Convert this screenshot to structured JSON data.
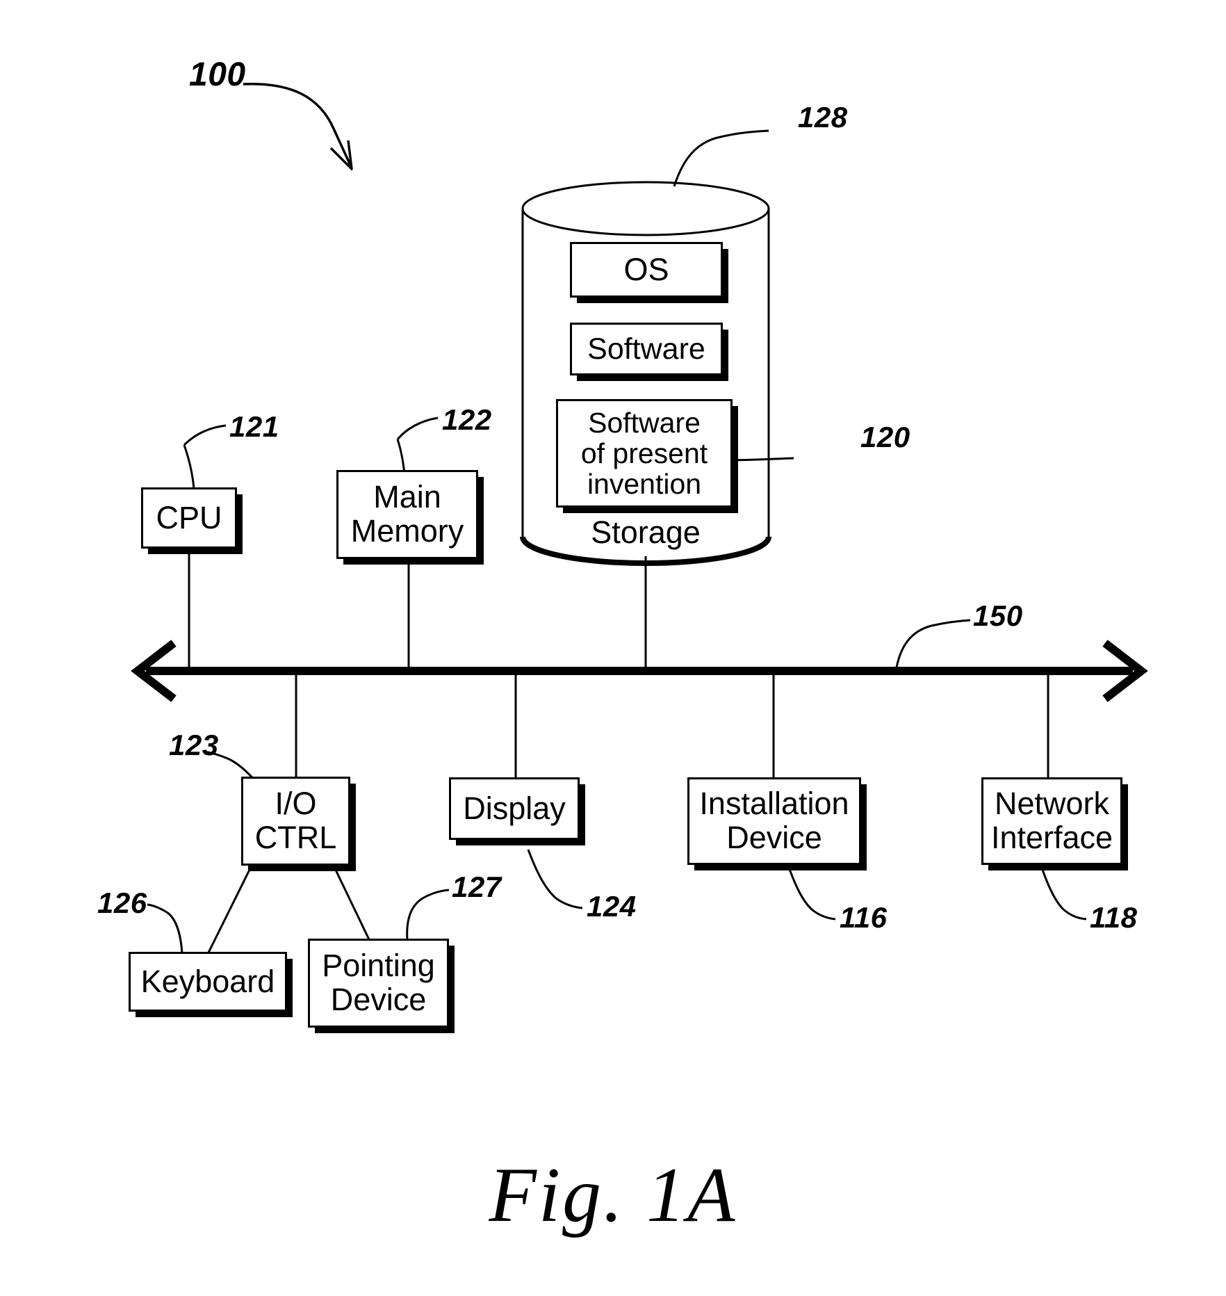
{
  "figure": {
    "caption": "Fig. 1A",
    "system_ref": "100"
  },
  "bus": {
    "ref": "150",
    "name": "system-bus"
  },
  "storage": {
    "ref_cylinder": "128",
    "ref_software_present_invention": "120",
    "label": "Storage",
    "items": [
      {
        "label": "OS",
        "name": "os-block"
      },
      {
        "label": "Software",
        "name": "software-block"
      },
      {
        "label": "Software\nof present\ninvention",
        "name": "software-present-invention-block"
      }
    ]
  },
  "nodes": {
    "cpu": {
      "label": "CPU",
      "ref": "121"
    },
    "main_memory": {
      "label": "Main\nMemory",
      "ref": "122"
    },
    "io_ctrl": {
      "label": "I/O\nCTRL",
      "ref": "123"
    },
    "display": {
      "label": "Display",
      "ref": "124"
    },
    "installation": {
      "label": "Installation\nDevice",
      "ref": "116"
    },
    "network": {
      "label": "Network\nInterface",
      "ref": "118"
    },
    "keyboard": {
      "label": "Keyboard",
      "ref": "126"
    },
    "pointing": {
      "label": "Pointing\nDevice",
      "ref": "127"
    }
  },
  "colors": {
    "line": "#000000",
    "background": "#ffffff"
  }
}
